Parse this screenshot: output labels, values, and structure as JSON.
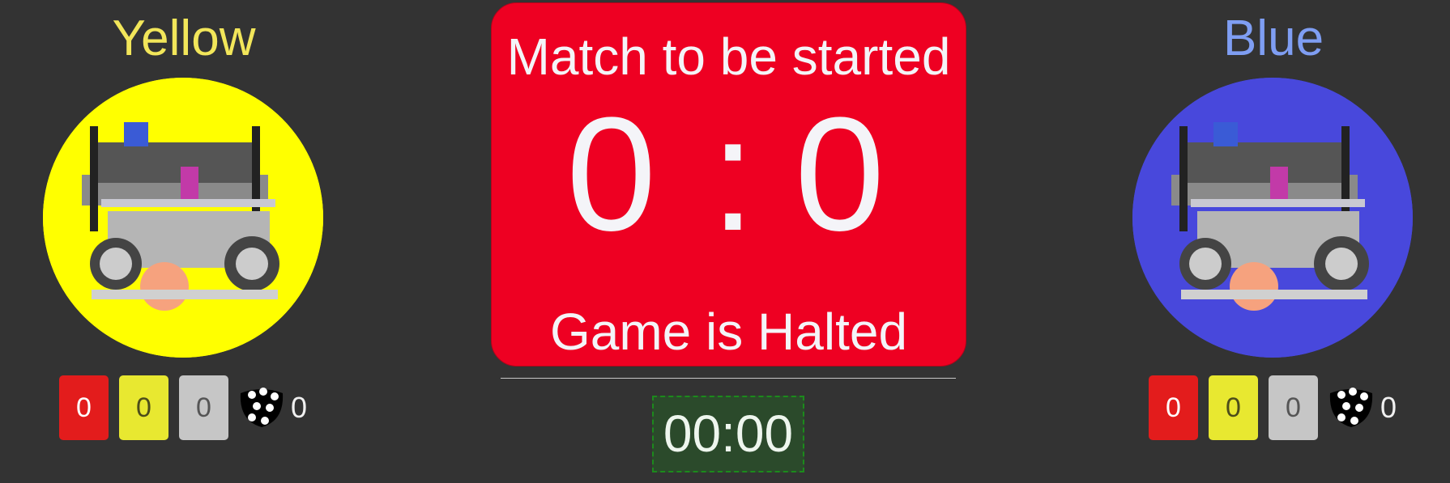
{
  "teams": {
    "yellow": {
      "name": "Yellow",
      "name_color": "#f2e65a",
      "logo_bg": "#ffff00",
      "red_cards": "0",
      "yellow_cards": "0",
      "grey_cards": "0",
      "ball_icon": "ball-icon",
      "ball_count": "0"
    },
    "blue": {
      "name": "Blue",
      "name_color": "#7f9ef3",
      "logo_bg": "#4848dc",
      "red_cards": "0",
      "yellow_cards": "0",
      "grey_cards": "0",
      "ball_icon": "ball-icon",
      "ball_count": "0"
    }
  },
  "scoreboard": {
    "match_state": "Match to be started",
    "score_yellow": "0",
    "separator": ":",
    "score_blue": "0",
    "game_state": "Game is Halted",
    "background": "#ee0022"
  },
  "timer": {
    "value": "00:00"
  }
}
